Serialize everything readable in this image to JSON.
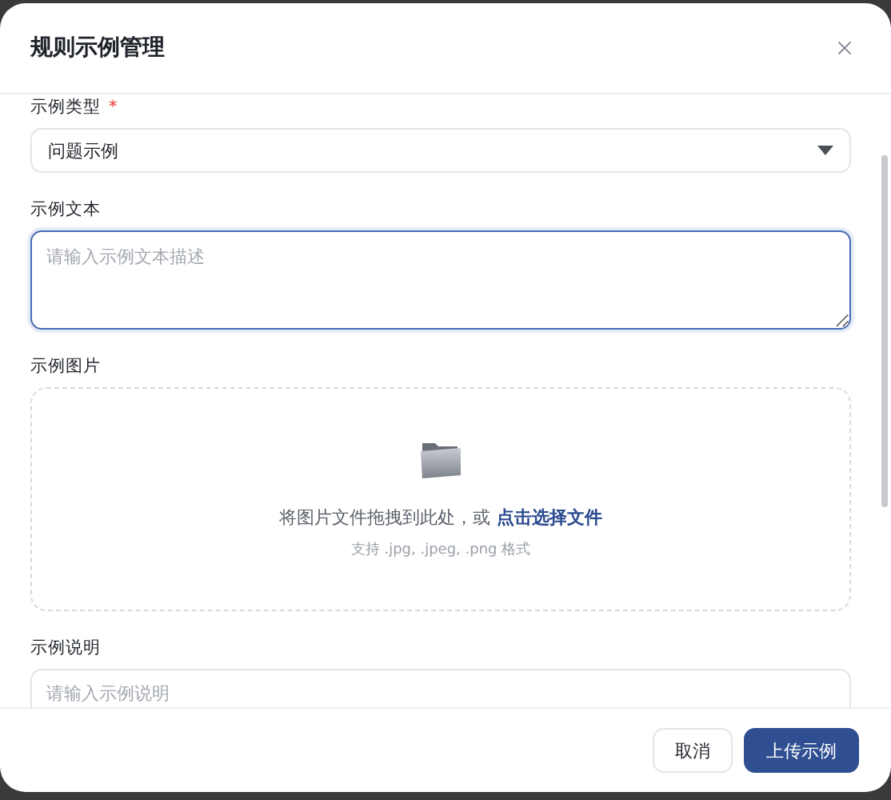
{
  "dialog": {
    "title": "规则示例管理"
  },
  "fields": [
    {
      "kind": "select",
      "label": "示例类型",
      "required_mark": "*",
      "value": "问题示例"
    },
    {
      "kind": "textarea",
      "label": "示例文本",
      "placeholder": "请输入示例文本描述",
      "focused": true
    },
    {
      "kind": "upload",
      "label": "示例图片",
      "prompt": "将图片文件拖拽到此处，或",
      "link": "点击选择文件",
      "hint": "支持 .jpg, .jpeg, .png 格式"
    },
    {
      "kind": "input",
      "label": "示例说明",
      "placeholder": "请输入示例说明",
      "focused": false
    }
  ],
  "buttons": [
    {
      "kind": "secondary",
      "label": "取消"
    },
    {
      "kind": "primary",
      "label": "上传示例"
    }
  ]
}
